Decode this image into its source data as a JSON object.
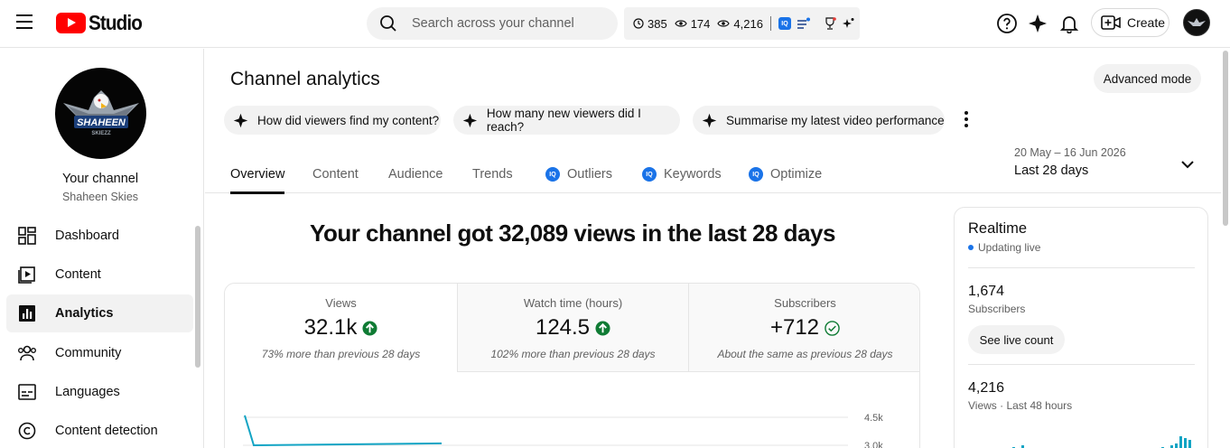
{
  "app": {
    "name": "Studio"
  },
  "search": {
    "placeholder": "Search across your channel"
  },
  "statsbar": {
    "stat1": "385",
    "stat2": "174",
    "stat3": "4,216"
  },
  "header": {
    "create_label": "Create"
  },
  "channel": {
    "title": "Your channel",
    "name": "Shaheen Skies",
    "logo_text": "SHAHEEN",
    "logo_subtext": "SKIEZZ"
  },
  "sidebar": {
    "items": [
      {
        "label": "Dashboard",
        "icon": "dashboard-icon"
      },
      {
        "label": "Content",
        "icon": "content-icon"
      },
      {
        "label": "Analytics",
        "icon": "analytics-icon",
        "active": true
      },
      {
        "label": "Community",
        "icon": "community-icon"
      },
      {
        "label": "Languages",
        "icon": "languages-icon"
      },
      {
        "label": "Content detection",
        "icon": "copyright-icon"
      }
    ]
  },
  "page": {
    "title": "Channel analytics",
    "advanced_label": "Advanced mode"
  },
  "suggestions": [
    "How did viewers find my content?",
    "How many new viewers did I reach?",
    "Summarise my latest video performance"
  ],
  "tabs": [
    "Overview",
    "Content",
    "Audience",
    "Trends",
    "Outliers",
    "Keywords",
    "Optimize"
  ],
  "tab_badge": "IQ",
  "date_range": {
    "range": "20 May – 16 Jun 2026",
    "label": "Last 28 days"
  },
  "headline": "Your channel got 32,089 views in the last 28 days",
  "cards": [
    {
      "label": "Views",
      "value": "32.1k",
      "comparison": "73% more than previous 28 days",
      "trend": "up"
    },
    {
      "label": "Watch time (hours)",
      "value": "124.5",
      "comparison": "102% more than previous 28 days",
      "trend": "up"
    },
    {
      "label": "Subscribers",
      "value": "+712",
      "comparison": "About the same as previous 28 days",
      "trend": "same"
    }
  ],
  "chart_data": {
    "type": "line",
    "ytick_labels": [
      "4.5k",
      "3.0k"
    ],
    "series": [
      {
        "values": [
          4600,
          3000,
          3100
        ]
      }
    ],
    "color": "#12a4c4"
  },
  "realtime": {
    "title": "Realtime",
    "status": "Updating live",
    "subscribers_value": "1,674",
    "subscribers_label": "Subscribers",
    "see_live_label": "See live count",
    "views_value": "4,216",
    "views_label": "Views · Last 48 hours"
  },
  "colors": {
    "accent": "#12a4c4",
    "brand": "#ff0000",
    "up": "#0f7b34",
    "iq": "#1a73e8"
  }
}
